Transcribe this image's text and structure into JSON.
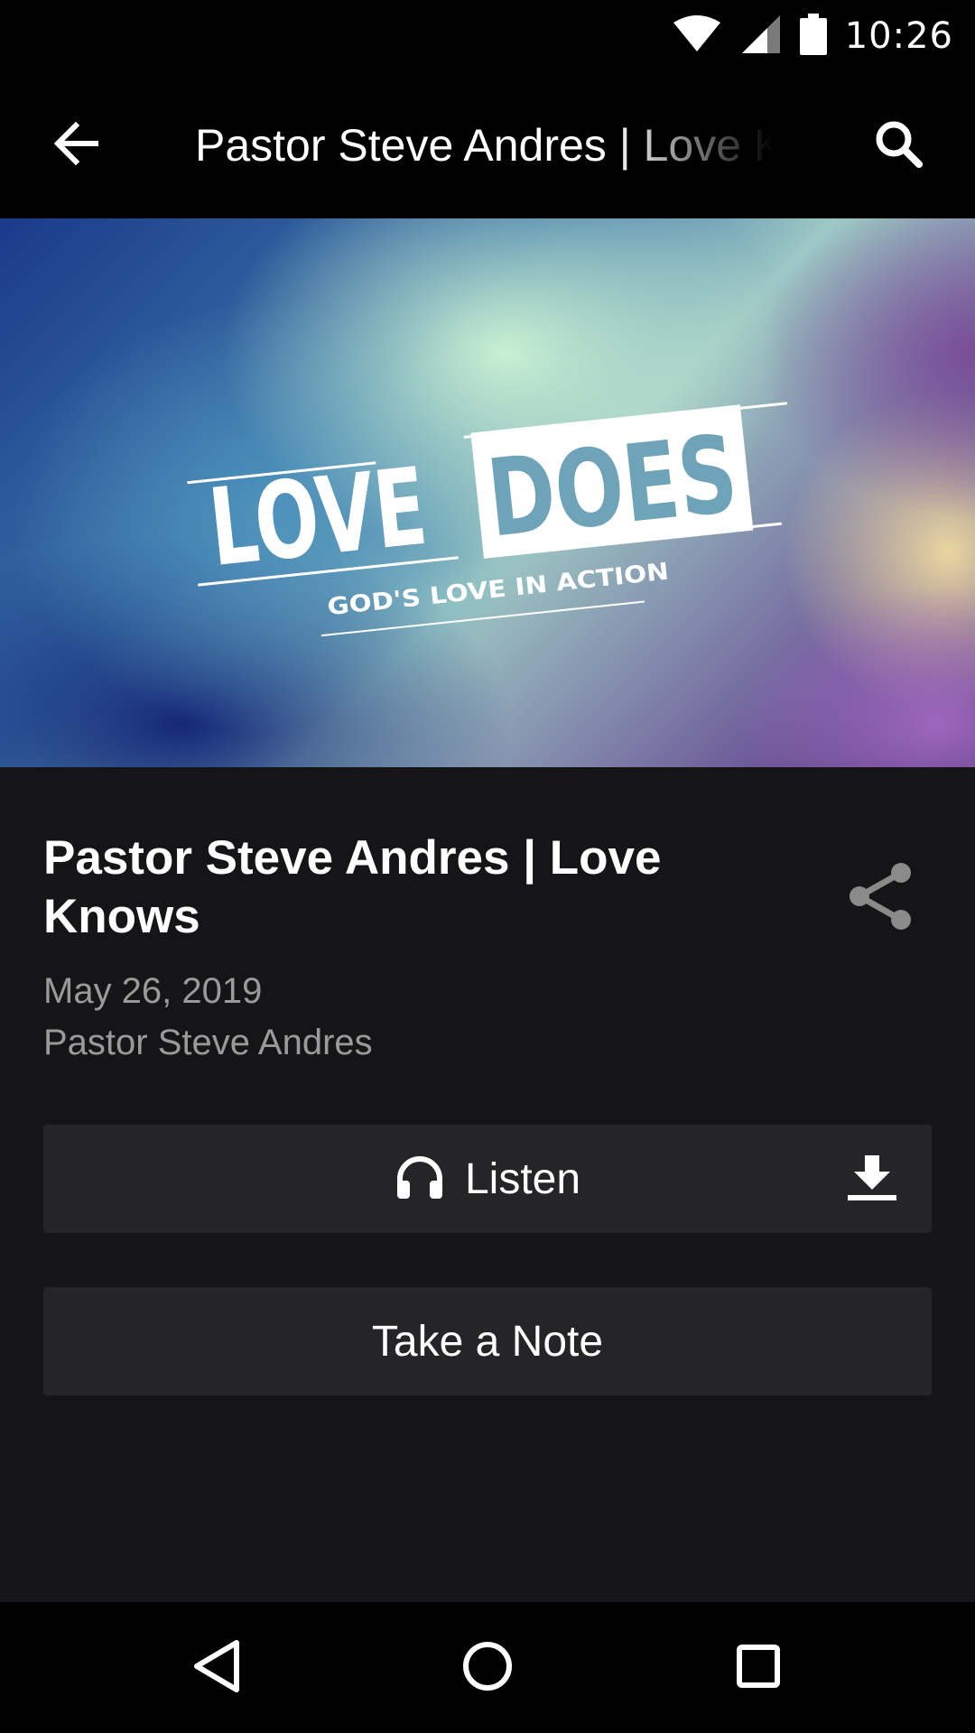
{
  "status_bar": {
    "time": "10:26",
    "icons": [
      "wifi-icon",
      "cell-signal-icon",
      "battery-icon"
    ]
  },
  "app_bar": {
    "title": "Pastor Steve Andres | Love Knows",
    "back_icon": "arrow-back-icon",
    "search_icon": "search-icon"
  },
  "hero": {
    "title_word_1": "LOVE",
    "title_word_2": "DOES",
    "tagline": "GOD'S LOVE IN ACTION"
  },
  "sermon": {
    "title": "Pastor Steve Andres | Love Knows",
    "date": "May 26, 2019",
    "speaker": "Pastor Steve Andres",
    "share_icon": "share-icon"
  },
  "actions": {
    "listen_label": "Listen",
    "listen_icon": "headphones-icon",
    "download_icon": "download-icon",
    "note_label": "Take a Note"
  },
  "nav_bar": {
    "back_icon": "nav-back-icon",
    "home_icon": "nav-home-icon",
    "recents_icon": "nav-recents-icon"
  },
  "colors": {
    "background": "#151517",
    "bar": "#000000",
    "button": "#252527",
    "secondary_text": "#9a9a9a"
  }
}
